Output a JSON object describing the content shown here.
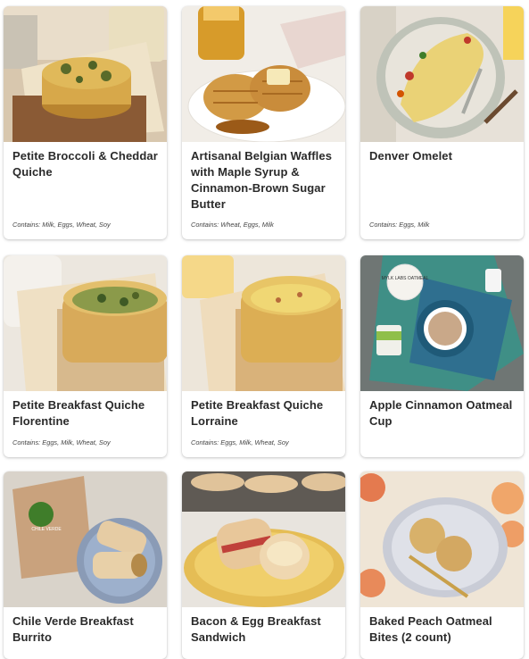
{
  "products": [
    {
      "title": "Petite Broccoli & Cheddar Quiche",
      "allergens": "Contains: Milk, Eggs, Wheat, Soy"
    },
    {
      "title": "Artisanal Belgian Waffles with Maple Syrup & Cinnamon-Brown Sugar Butter",
      "allergens": "Contains: Wheat, Eggs, Milk"
    },
    {
      "title": "Denver Omelet",
      "allergens": "Contains: Eggs, Milk"
    },
    {
      "title": "Petite Breakfast Quiche Florentine",
      "allergens": "Contains: Eggs, Milk, Wheat, Soy"
    },
    {
      "title": "Petite Breakfast Quiche Lorraine",
      "allergens": "Contains: Eggs, Milk, Wheat, Soy"
    },
    {
      "title": "Apple Cinnamon Oatmeal Cup",
      "allergens": ""
    },
    {
      "title": "Chile Verde Breakfast Burrito",
      "allergens": ""
    },
    {
      "title": "Bacon & Egg Breakfast Sandwich",
      "allergens": ""
    },
    {
      "title": "Baked Peach Oatmeal Bites (2 count)",
      "allergens": ""
    }
  ],
  "package_labels": {
    "oatmeal_lid": "MYLK LABS OATMEAL",
    "burrito_wrapper": "CHILE VERDE"
  }
}
